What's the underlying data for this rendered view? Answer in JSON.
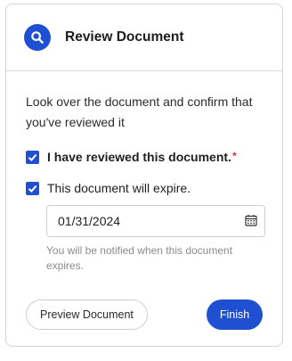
{
  "header": {
    "title": "Review Document",
    "icon": "search-icon",
    "accent": "#1f50d2"
  },
  "intro_text": "Look over the document and confirm that you've reviewed it",
  "checkbox_reviewed": {
    "label": "I have reviewed this document.",
    "required_mark": "*",
    "checked": true
  },
  "checkbox_expire": {
    "label": "This document will expire.",
    "checked": true
  },
  "expiry": {
    "date_value": "01/31/2024",
    "icon": "calendar-icon",
    "help_text": "You will be notified when this document expires."
  },
  "actions": {
    "preview_label": "Preview Document",
    "finish_label": "Finish"
  }
}
